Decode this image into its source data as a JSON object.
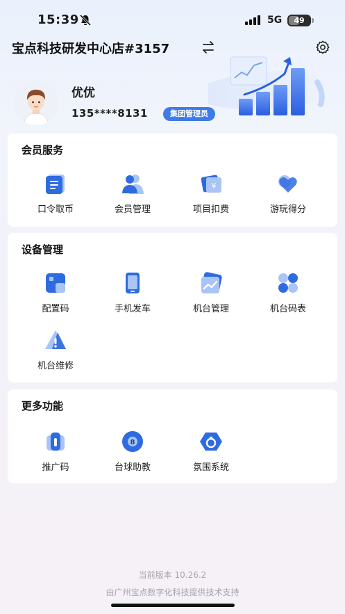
{
  "status_bar": {
    "time": "15:39",
    "network": "5G",
    "battery_percent": "49",
    "battery_level": 0.49
  },
  "header": {
    "store_name": "宝点科技研发中心店#3157"
  },
  "user": {
    "name": "优优",
    "phone": "135****8131",
    "role": "集团管理员"
  },
  "sections": [
    {
      "title": "会员服务",
      "items": [
        {
          "label": "口令取币",
          "icon": "document-icon"
        },
        {
          "label": "会员管理",
          "icon": "users-icon"
        },
        {
          "label": "项目扣费",
          "icon": "yen-card-icon"
        },
        {
          "label": "游玩得分",
          "icon": "heart-icon"
        }
      ]
    },
    {
      "title": "设备管理",
      "items": [
        {
          "label": "配置码",
          "icon": "grid-code-icon"
        },
        {
          "label": "手机发车",
          "icon": "phone-icon"
        },
        {
          "label": "机台管理",
          "icon": "chart-card-icon"
        },
        {
          "label": "机台码表",
          "icon": "clover-icon"
        },
        {
          "label": "机台维修",
          "icon": "warning-triangle-icon"
        }
      ]
    },
    {
      "title": "更多功能",
      "items": [
        {
          "label": "推广码",
          "icon": "promo-icon"
        },
        {
          "label": "台球助教",
          "icon": "billiard-ball-icon"
        },
        {
          "label": "氛围系统",
          "icon": "ring-hexagon-icon"
        }
      ]
    }
  ],
  "footer": {
    "version": "当前版本 10.26.2",
    "credit": "由广州宝点数字化科技提供技术支持"
  },
  "colors": {
    "accent": "#3f7ae6",
    "icon_dark": "#2f6be0",
    "icon_light": "#a9c4f5"
  }
}
